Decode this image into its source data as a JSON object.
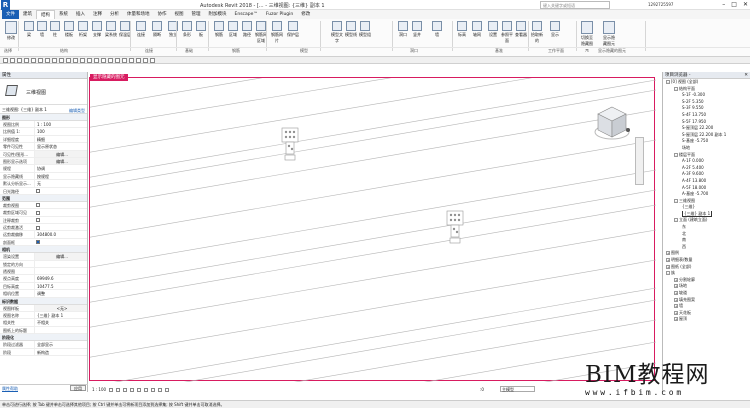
{
  "app": {
    "title": "Autodesk Revit 2018 -",
    "view_title": "[... - 三维视图: {三维} 副本 1",
    "search_placeholder": "键入关键字或短语",
    "user": "1292725597",
    "logo": "R"
  },
  "tabs": [
    "文件",
    "建筑",
    "结构",
    "系统",
    "插入",
    "注释",
    "分析",
    "体量和场地",
    "协作",
    "视图",
    "管理",
    "附加模块",
    "Enscape™",
    "Fuzor Plugin",
    "修改"
  ],
  "active_tab": "结构",
  "ribbon": {
    "buttons": [
      "修改",
      "梁",
      "墙",
      "柱",
      "楼板",
      "桁架",
      "支撑",
      "梁系统",
      "保温层",
      "连接",
      "隔断",
      "独立",
      "条形",
      "板",
      "钢筋",
      "区域",
      "路径",
      "钢筋网区域",
      "钢筋网片",
      "保护层",
      "模型文字",
      "模型线",
      "模型组",
      "洞口",
      "竖井",
      "墙",
      "标高",
      "轴网",
      "设置",
      "参照平面",
      "查看器",
      "拾取新的",
      "显示",
      "切换至隐藏图元",
      "显示隐藏图元"
    ],
    "groups": [
      "选择",
      "结构",
      "连接",
      "基础",
      "钢筋",
      "模型",
      "洞口",
      "基准",
      "工作平面",
      "显示隐藏的图元"
    ],
    "select_label": "选择 ▾"
  },
  "viewport_tab": "显示隐藏的图元",
  "properties": {
    "header": "属性",
    "type_name": "三维视图",
    "view_selector": "三维视图: {三维} 副本 1",
    "edit_type": "编辑类型",
    "sections": [
      {
        "title": "图形",
        "rows": [
          {
            "k": "视图比例",
            "v": "1 : 100"
          },
          {
            "k": "比例值 1:",
            "v": "100"
          },
          {
            "k": "详细程度",
            "v": "精细"
          },
          {
            "k": "零件可见性",
            "v": "显示原状态"
          },
          {
            "k": "可见性/图形...",
            "v": "编辑...",
            "btn": true
          },
          {
            "k": "图形显示选项",
            "v": "编辑...",
            "btn": true
          },
          {
            "k": "规程",
            "v": "协调"
          },
          {
            "k": "显示隐藏线",
            "v": "按规程"
          },
          {
            "k": "默认分析显示...",
            "v": "无"
          },
          {
            "k": "日光路径",
            "v": "",
            "cb": false
          }
        ]
      },
      {
        "title": "范围",
        "rows": [
          {
            "k": "裁剪视图",
            "v": "",
            "cb": false
          },
          {
            "k": "裁剪区域可见",
            "v": "",
            "cb": false
          },
          {
            "k": "注释裁剪",
            "v": "",
            "cb": false
          },
          {
            "k": "远剪裁激活",
            "v": "",
            "cb": false
          },
          {
            "k": "远剪裁偏移",
            "v": "304800.0"
          },
          {
            "k": "剖面框",
            "v": "",
            "cb": true
          }
        ]
      },
      {
        "title": "相机",
        "rows": [
          {
            "k": "渲染设置",
            "v": "编辑...",
            "btn": true
          },
          {
            "k": "锁定的方向",
            "v": ""
          },
          {
            "k": "透视图",
            "v": ""
          },
          {
            "k": "视点高度",
            "v": "69949.6"
          },
          {
            "k": "目标高度",
            "v": "10477.5"
          },
          {
            "k": "相机位置",
            "v": "调整"
          }
        ]
      },
      {
        "title": "标识数据",
        "rows": [
          {
            "k": "视图样板",
            "v": "<无>",
            "btn": true
          },
          {
            "k": "视图名称",
            "v": "{三维} 副本 1"
          },
          {
            "k": "相关性",
            "v": "不相关"
          },
          {
            "k": "图纸上的标题",
            "v": ""
          }
        ]
      },
      {
        "title": "阶段化",
        "rows": [
          {
            "k": "阶段过滤器",
            "v": "全部显示"
          },
          {
            "k": "阶段",
            "v": "新构造"
          }
        ]
      }
    ],
    "help_link": "属性帮助",
    "apply": "应用"
  },
  "browser": {
    "header": "项目浏览器 - ",
    "nodes": [
      {
        "t": "[0] 视图 (全部)",
        "l": 0,
        "tg": "-"
      },
      {
        "t": "结构平面",
        "l": 1,
        "tg": "-"
      },
      {
        "t": "S-1F -0.300",
        "l": 2
      },
      {
        "t": "S-2F 5.350",
        "l": 2
      },
      {
        "t": "S-3F 9.550",
        "l": 2
      },
      {
        "t": "S-4F 13.750",
        "l": 2
      },
      {
        "t": "S-5F 17.950",
        "l": 2
      },
      {
        "t": "S-屋顶层 22.200",
        "l": 2
      },
      {
        "t": "S-屋顶层 22.200 副本 1",
        "l": 2
      },
      {
        "t": "S-基座 -5.750",
        "l": 2
      },
      {
        "t": "场地",
        "l": 2
      },
      {
        "t": "楼层平面",
        "l": 1,
        "tg": "-"
      },
      {
        "t": "A-1F 0.000",
        "l": 2
      },
      {
        "t": "A-2F 5.400",
        "l": 2
      },
      {
        "t": "A-3F 9.600",
        "l": 2
      },
      {
        "t": "A-4F 13.800",
        "l": 2
      },
      {
        "t": "A-5F 18.000",
        "l": 2
      },
      {
        "t": "A-基座 -5.700",
        "l": 2
      },
      {
        "t": "三维视图",
        "l": 1,
        "tg": "-"
      },
      {
        "t": "{三维}",
        "l": 2
      },
      {
        "t": "{三维} 副本 1",
        "l": 2,
        "sel": true
      },
      {
        "t": "立面 (建筑立面)",
        "l": 1,
        "tg": "-"
      },
      {
        "t": "东",
        "l": 2
      },
      {
        "t": "北",
        "l": 2
      },
      {
        "t": "南",
        "l": 2
      },
      {
        "t": "西",
        "l": 2
      },
      {
        "t": "图例",
        "l": 0,
        "tg": "+"
      },
      {
        "t": "明细表/数量",
        "l": 0,
        "tg": "+"
      },
      {
        "t": "图纸 (全部)",
        "l": 0,
        "tg": "+"
      },
      {
        "t": "族",
        "l": 0,
        "tg": "-"
      },
      {
        "t": "分割轮廓",
        "l": 1,
        "tg": "+"
      },
      {
        "t": "场地",
        "l": 1,
        "tg": "+"
      },
      {
        "t": "坡道",
        "l": 1,
        "tg": "+"
      },
      {
        "t": "填充图案",
        "l": 1,
        "tg": "+"
      },
      {
        "t": "墙",
        "l": 1,
        "tg": "+"
      },
      {
        "t": "天花板",
        "l": 1,
        "tg": "+"
      },
      {
        "t": "屋顶",
        "l": 1,
        "tg": "+"
      }
    ]
  },
  "view_control": {
    "scale": "1 : 100"
  },
  "model_bar": {
    "zero": ":0",
    "model": "主模型"
  },
  "status": {
    "text": "单击可进行选择; 按 Tab 键并单击可选择其他项目; 按 Ctrl 键并单击可将新项目添加到选择集; 按 Shift 键并单击可取消选择。"
  },
  "watermark": {
    "big": "BIM教程网",
    "url": "www.ifbim.com"
  }
}
